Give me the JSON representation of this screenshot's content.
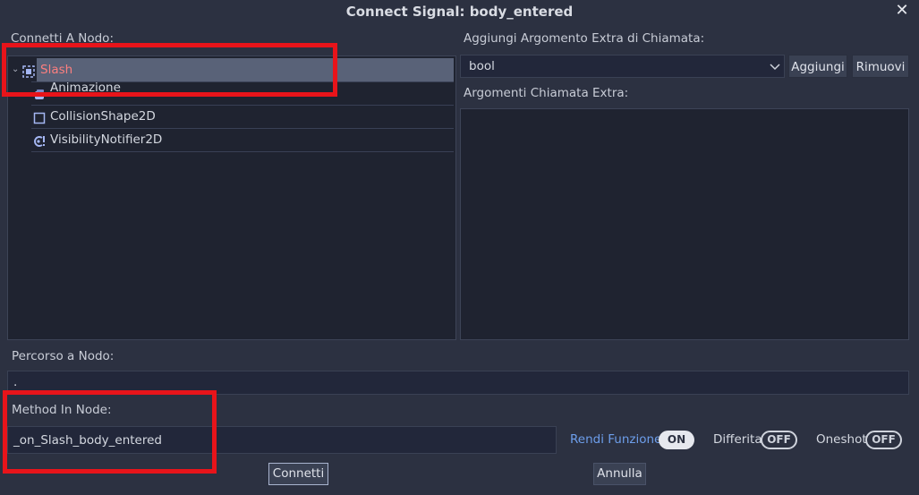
{
  "dialog": {
    "title": "Connect Signal: body_entered"
  },
  "left": {
    "connect_label": "Connetti A Nodo:",
    "tree": [
      {
        "label": "Slash",
        "icon": "area2d-icon"
      },
      {
        "label": "Animazione",
        "icon": "animated-sprite-icon"
      },
      {
        "label": "CollisionShape2D",
        "icon": "collision-shape-icon"
      },
      {
        "label": "VisibilityNotifier2D",
        "icon": "visibility-notifier-icon"
      }
    ]
  },
  "right": {
    "extra_arg_label": "Aggiungi Argomento Extra di Chiamata:",
    "type_select": "bool",
    "add_button": "Aggiungi",
    "remove_button": "Rimuovi",
    "extra_args_label": "Argomenti Chiamata Extra:"
  },
  "path": {
    "label": "Percorso a Nodo:",
    "value": "."
  },
  "method": {
    "label": "Method In Node:",
    "value": "_on_Slash_body_entered"
  },
  "toggles": {
    "make_function_label": "Rendi Funzione",
    "make_function_state": "ON",
    "deferred_label": "Differita",
    "deferred_state": "OFF",
    "oneshot_label": "Oneshot",
    "oneshot_state": "OFF"
  },
  "footer": {
    "connect_button": "Connetti",
    "cancel_button": "Annulla"
  },
  "colors": {
    "accent": "#6d9eeb",
    "selected_node": "#fc7f7f",
    "highlight": "#e8141a"
  }
}
